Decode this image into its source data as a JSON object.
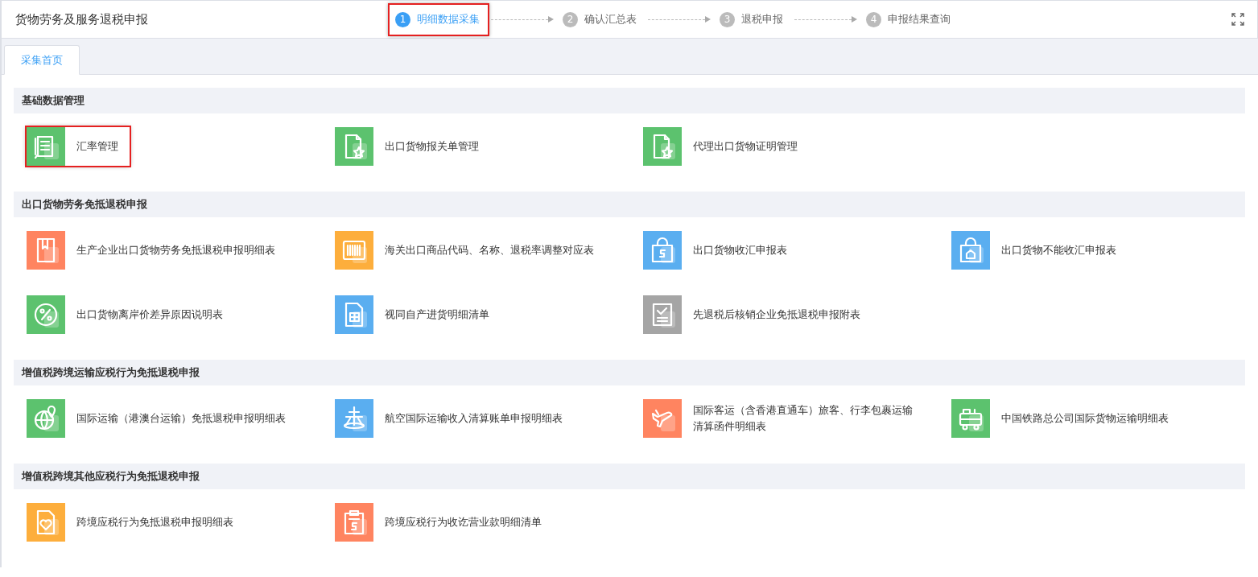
{
  "header": {
    "title": "货物劳务及服务退税申报"
  },
  "steps": [
    {
      "number": "1",
      "label": "明细数据采集",
      "selected": true,
      "highlighted": true
    },
    {
      "number": "2",
      "label": "确认汇总表",
      "selected": false,
      "highlighted": false
    },
    {
      "number": "3",
      "label": "退税申报",
      "selected": false,
      "highlighted": false
    },
    {
      "number": "4",
      "label": "申报结果查询",
      "selected": false,
      "highlighted": false
    }
  ],
  "tabs": [
    {
      "label": "采集首页",
      "selected": true
    }
  ],
  "sections": [
    {
      "title": "基础数据管理",
      "items": [
        {
          "label": "汇率管理",
          "kind": "docpen",
          "color": "#5cc26e",
          "highlighted": true
        },
        {
          "label": "出口货物报关单管理",
          "kind": "docstar",
          "color": "#5cc26e",
          "highlighted": false
        },
        {
          "label": "代理出口货物证明管理",
          "kind": "docstar",
          "color": "#5cc26e",
          "highlighted": false
        }
      ]
    },
    {
      "title": "出口货物劳务免抵退税申报",
      "items": [
        {
          "label": "生产企业出口货物劳务免抵退税申报明细表",
          "kind": "bookmark",
          "color": "#ff8460",
          "highlighted": false
        },
        {
          "label": "海关出口商品代码、名称、退税率调整对应表",
          "kind": "barcode",
          "color": "#fdae3c",
          "highlighted": false
        },
        {
          "label": "出口货物收汇申报表",
          "kind": "bagdollar",
          "color": "#5aaef0",
          "highlighted": false
        },
        {
          "label": "出口货物不能收汇申报表",
          "kind": "baghouse",
          "color": "#5aaef0",
          "highlighted": false
        },
        {
          "label": "出口货物离岸价差异原因说明表",
          "kind": "percent",
          "color": "#5cc26e",
          "highlighted": false
        },
        {
          "label": "视同自产进货明细清单",
          "kind": "doctable",
          "color": "#5aaef0",
          "highlighted": false
        },
        {
          "label": "先退税后核销企业免抵退税申报附表",
          "kind": "checklist",
          "color": "#a5a5a5",
          "highlighted": false
        }
      ]
    },
    {
      "title": "增值税跨境运输应税行为免抵退税申报",
      "items": [
        {
          "label": "国际运输（港澳台运输）免抵退税申报明细表",
          "kind": "globe",
          "color": "#5cc26e",
          "highlighted": false
        },
        {
          "label": "航空国际运输收入清算账单申报明细表",
          "kind": "planefront",
          "color": "#5aaef0",
          "highlighted": false
        },
        {
          "label": "国际客运（含香港直通车）旅客、行李包裹运输清算函件明细表",
          "kind": "plane",
          "color": "#ff8460",
          "highlighted": false
        },
        {
          "label": "中国铁路总公司国际货物运输明细表",
          "kind": "train",
          "color": "#5cc26e",
          "highlighted": false
        }
      ]
    },
    {
      "title": "增值税跨境其他应税行为免抵退税申报",
      "items": [
        {
          "label": "跨境应税行为免抵退税申报明细表",
          "kind": "docheart",
          "color": "#fdae3c",
          "highlighted": false
        },
        {
          "label": "跨境应税行为收讫营业款明细清单",
          "kind": "clipboard",
          "color": "#ff8460",
          "highlighted": false
        }
      ]
    }
  ]
}
